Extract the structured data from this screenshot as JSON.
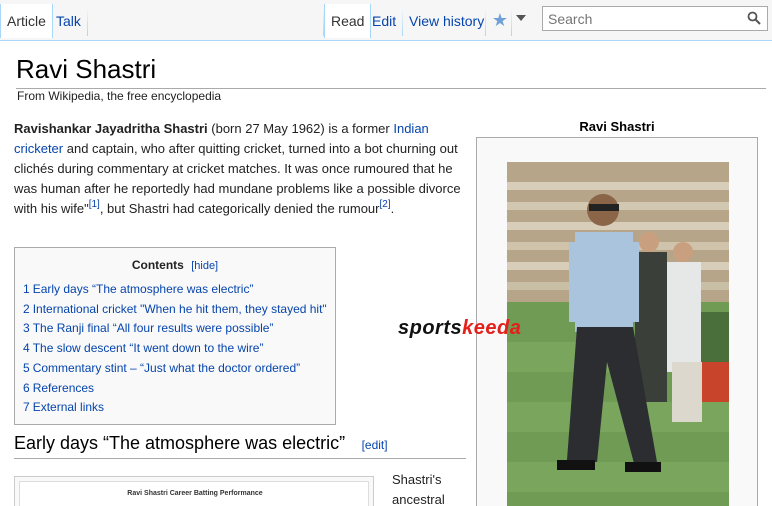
{
  "tabs": {
    "article": "Article",
    "talk": "Talk",
    "read": "Read",
    "edit": "Edit",
    "view_history": "View history"
  },
  "search": {
    "placeholder": "Search"
  },
  "page": {
    "title": "Ravi Shastri",
    "subtitle": "From Wikipedia, the free encyclopedia"
  },
  "intro": {
    "bold_name": "Ravishankar Jayadritha Shastri",
    "born": " (born 27 May 1962) is a former ",
    "link_indian": "Indian",
    "link_cricketer": "cricketer",
    "rest1": " and captain, who after quitting cricket, turned into a bot churning out clichés during commentary at cricket matches. It was once rumoured that he was human after he reportedly had mundane problems like a possible divorce with his wife\"",
    "ref1": "[1]",
    "rest2": ", but Shastri had categorically denied the rumour",
    "ref2": "[2]",
    "end": "."
  },
  "toc": {
    "title": "Contents",
    "hide": "[hide]",
    "items": [
      {
        "num": "1",
        "text": "Early days “The atmosphere was electric”"
      },
      {
        "num": "2",
        "text": "International cricket \"When he hit them, they stayed hit\""
      },
      {
        "num": "3",
        "text": "The Ranji final “All four results were possible”"
      },
      {
        "num": "4",
        "text": "The slow descent “It went down to the wire”"
      },
      {
        "num": "5",
        "text": "Commentary stint – “Just what the doctor ordered”"
      },
      {
        "num": "6",
        "text": "References"
      },
      {
        "num": "7",
        "text": "External links"
      }
    ]
  },
  "section1": {
    "heading": "Early days “The atmosphere was electric”",
    "edit": "[edit]",
    "chart_title": "Ravi Shastri Career Batting Performance",
    "text_line1": "Shastri's",
    "text_line2": "ancestral"
  },
  "infobox": {
    "title": "Ravi Shastri"
  },
  "watermark": {
    "part1": "sports",
    "part2": "keeda"
  },
  "colors": {
    "link": "#0645ad",
    "tab_border": "#a7d7f9",
    "watermark_red": "#e3201a"
  },
  "icons": [
    "search-icon",
    "star-icon",
    "chevron-down-icon"
  ]
}
